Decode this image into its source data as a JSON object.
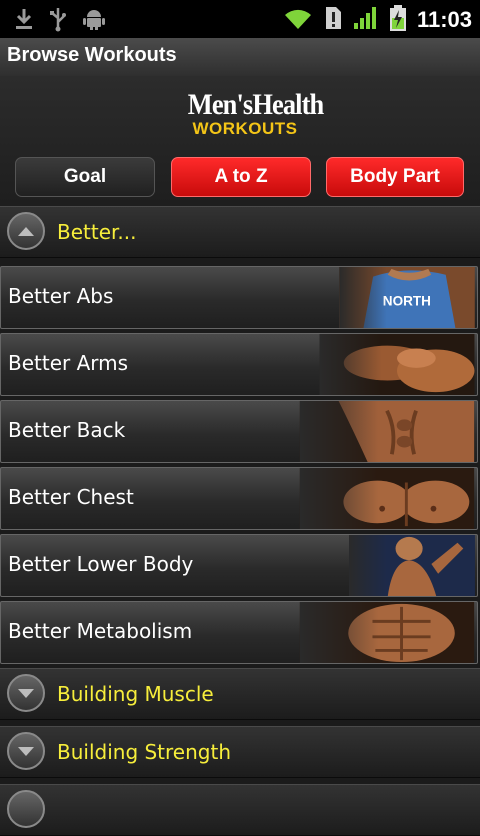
{
  "status_bar": {
    "time": "11:03",
    "icons": [
      "download-icon",
      "usb-icon",
      "android-icon",
      "wifi-icon",
      "alert-icon",
      "signal-icon",
      "battery-charging-icon"
    ]
  },
  "header": {
    "title": "Browse Workouts"
  },
  "logo": {
    "line1": "Men'sHealth",
    "line2": "WORKOUTS"
  },
  "tabs": [
    {
      "label": "Goal",
      "state": "unselected"
    },
    {
      "label": "A to Z",
      "state": "selected"
    },
    {
      "label": "Body Part",
      "state": "selected"
    }
  ],
  "groups": [
    {
      "title": "Better...",
      "expanded": true,
      "items": [
        {
          "label": "Better Abs"
        },
        {
          "label": "Better Arms"
        },
        {
          "label": "Better Back"
        },
        {
          "label": "Better Chest"
        },
        {
          "label": "Better Lower Body"
        },
        {
          "label": "Better Metabolism"
        }
      ]
    },
    {
      "title": "Building Muscle",
      "expanded": false,
      "items": []
    },
    {
      "title": "Building Strength",
      "expanded": false,
      "items": []
    }
  ],
  "colors": {
    "accent_yellow": "#f7ee3b",
    "tab_red": "#e01818",
    "logo_yellow": "#f4c517"
  }
}
